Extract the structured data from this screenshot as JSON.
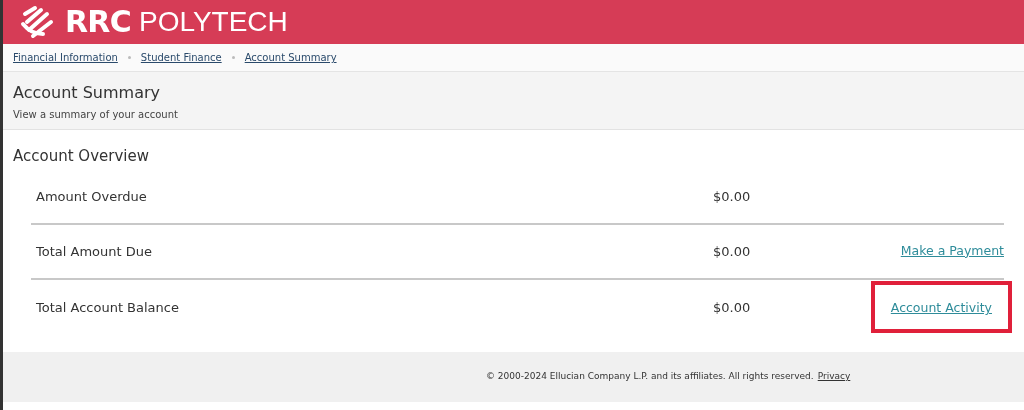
{
  "header": {
    "logo_bold": "RRC",
    "logo_light": "POLYTECH"
  },
  "breadcrumbs": [
    {
      "label": "Financial Information"
    },
    {
      "label": "Student Finance"
    },
    {
      "label": "Account Summary"
    }
  ],
  "page": {
    "title": "Account Summary",
    "subtitle": "View a summary of your account"
  },
  "overview": {
    "title": "Account Overview",
    "rows": [
      {
        "label": "Amount Overdue",
        "amount": "$0.00"
      },
      {
        "label": "Total Amount Due",
        "amount": "$0.00",
        "link": "Make a Payment"
      },
      {
        "label": "Total Account Balance",
        "amount": "$0.00",
        "link": "Account Activity",
        "highlighted": true
      }
    ]
  },
  "footer": {
    "text": "© 2000-2024 Ellucian Company L.P. and its affiliates. All rights reserved.",
    "link": "Privacy"
  }
}
